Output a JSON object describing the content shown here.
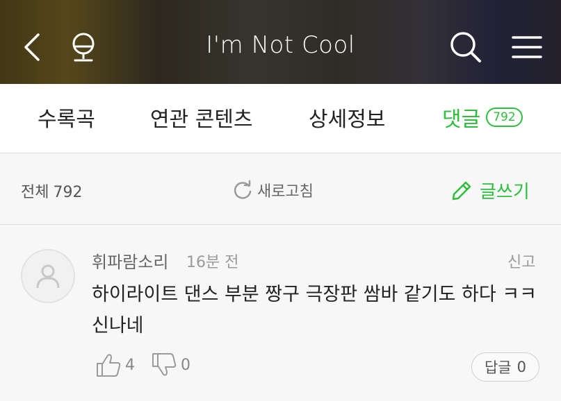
{
  "header": {
    "title": "I'm Not Cool",
    "icons": [
      "back-arrow-icon",
      "microphone-icon",
      "search-icon",
      "hamburger-menu-icon"
    ]
  },
  "tabs": [
    {
      "label": "수록곡"
    },
    {
      "label": "연관 콘텐츠"
    },
    {
      "label": "상세정보"
    },
    {
      "label": "댓글",
      "badge": "792",
      "active": true
    }
  ],
  "subbar": {
    "total_label": "전체",
    "total_count": "792",
    "refresh_label": "새로고침",
    "write_label": "글쓰기"
  },
  "comment": {
    "author": "휘파람소리",
    "time": "16분 전",
    "report_label": "신고",
    "text": "하이라이트 댄스 부분 짱구 극장판 쌈바 같기도 하다 ㅋㅋ 신나네",
    "likes": "4",
    "dislikes": "0",
    "reply_label": "답글",
    "reply_count": "0"
  },
  "colors": {
    "accent": "#2dbe3c",
    "background": "#f7f7f7"
  }
}
